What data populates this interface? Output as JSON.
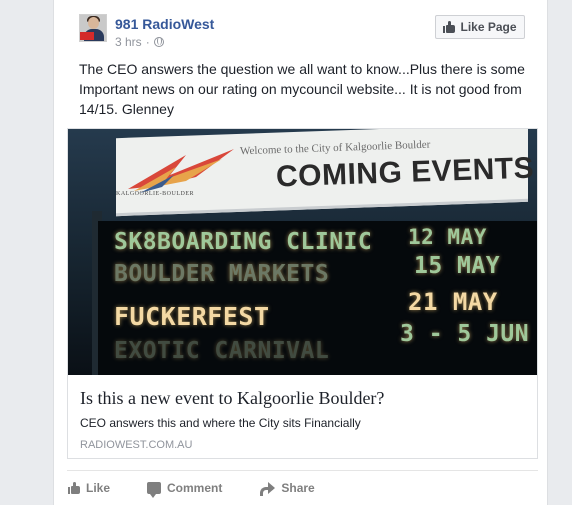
{
  "post": {
    "page_name": "981 RadioWest",
    "time": "3 hrs",
    "separator": "·",
    "like_page_label": "Like Page",
    "text": "The CEO answers the question we all want to know...Plus there is some Important news on our rating on mycouncil website... It is not good from 14/15. Glenney"
  },
  "photo": {
    "welcome_text": "Welcome to the City of Kalgoorlie Boulder",
    "logo_caption": "KALGOORLIE-BOULDER",
    "heading": "COMING EVENTS",
    "events": [
      {
        "name": "SK8BOARDING CLINIC",
        "date": "12 MAY"
      },
      {
        "name": "BOULDER MARKETS",
        "date": "15 MAY"
      },
      {
        "name": "FUCKERFEST",
        "date": "21 MAY"
      },
      {
        "name": "EXOTIC CARNIVAL",
        "date": "3 - 5 JUN"
      }
    ]
  },
  "link": {
    "title": "Is this a new event to Kalgoorlie Boulder?",
    "description": "CEO answers this and where the City sits Financially",
    "domain": "RADIOWEST.COM.AU"
  },
  "actions": {
    "like_label": "Like",
    "comment_label": "Comment",
    "share_label": "Share"
  },
  "colors": {
    "link_blue": "#365899",
    "meta_gray": "#90949c",
    "background": "#e9ebee"
  }
}
